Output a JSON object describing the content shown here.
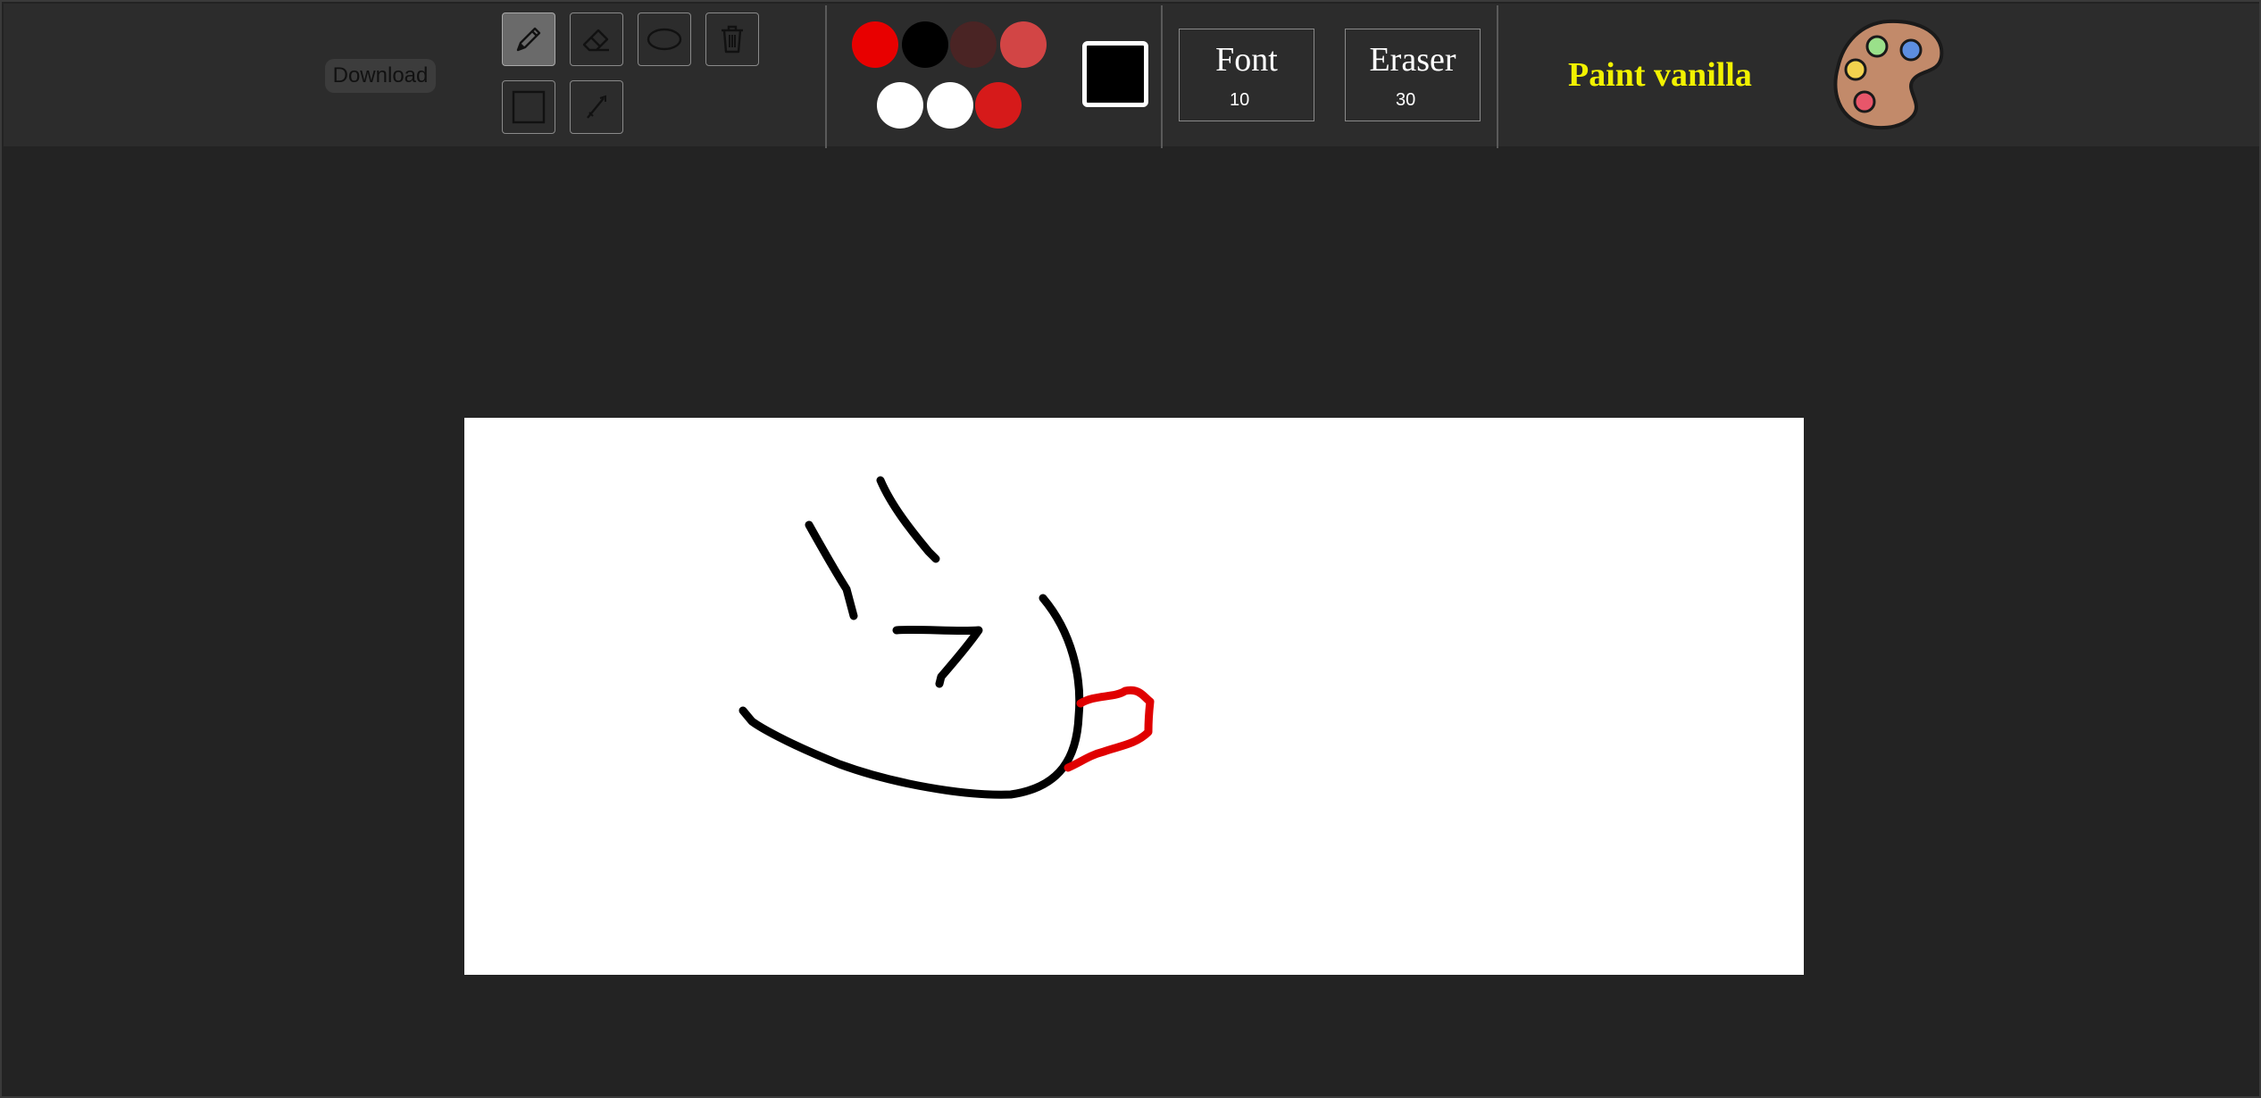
{
  "toolbar": {
    "download_label": "Download",
    "tools": [
      {
        "name": "pencil",
        "active": true
      },
      {
        "name": "eraser",
        "active": false
      },
      {
        "name": "ellipse",
        "active": false
      },
      {
        "name": "trash",
        "active": false
      },
      {
        "name": "rectangle",
        "active": false
      },
      {
        "name": "line",
        "active": false
      }
    ],
    "swatches": [
      "#e80000",
      "#000000",
      "#4a2424",
      "#d24545",
      "#ffffff",
      "#ffffff",
      "#d61a1a"
    ],
    "current_color": "#000000",
    "font": {
      "label": "Font",
      "value": "10"
    },
    "eraser": {
      "label": "Eraser",
      "value": "30"
    },
    "brand": "Paint vanilla",
    "brand_color": "#f2f200"
  },
  "drawing": {
    "stroke_colors": [
      "#000000",
      "#e00000"
    ]
  }
}
